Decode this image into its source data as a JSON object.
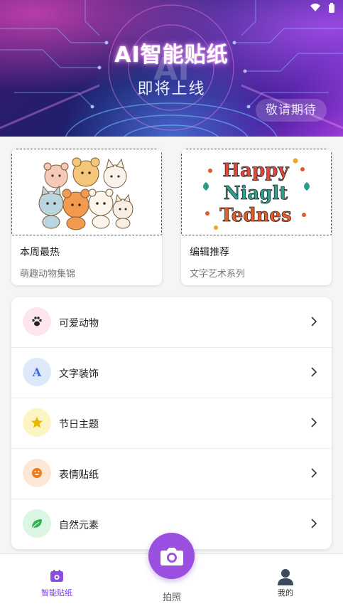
{
  "banner": {
    "title": "AI智能贴纸",
    "ghost_text": "AI",
    "subtitle": "即将上线",
    "button_label": "敬请期待"
  },
  "featured": [
    {
      "title": "本周最热",
      "desc": "萌趣动物集锦",
      "image": "cute-animals-stickers"
    },
    {
      "title": "编辑推荐",
      "desc": "文字艺术系列",
      "image": "text-art-sticker",
      "image_text": [
        "Happy",
        "Niaglt",
        "Tednes"
      ]
    }
  ],
  "categories": [
    {
      "label": "可爱动物",
      "icon": "paw-icon",
      "icon_bg": "#fde4ef",
      "icon_color": "#222222"
    },
    {
      "label": "文字装饰",
      "icon": "letter-a-icon",
      "icon_text": "A",
      "icon_bg": "#dde8fb",
      "icon_color": "#3b6fd8"
    },
    {
      "label": "节日主题",
      "icon": "star-icon",
      "icon_bg": "#fdf4c4",
      "icon_color": "#e6b800"
    },
    {
      "label": "表情贴纸",
      "icon": "smiley-icon",
      "icon_bg": "#fde7d6",
      "icon_color": "#f27a1a"
    },
    {
      "label": "自然元素",
      "icon": "leaf-icon",
      "icon_bg": "#dcf6e4",
      "icon_color": "#2fb350"
    }
  ],
  "nav": {
    "home_label": "智能贴纸",
    "camera_label": "拍照",
    "me_label": "我的"
  },
  "colors": {
    "accent": "#7c3aed",
    "camera_button": "#9b4fe0"
  }
}
